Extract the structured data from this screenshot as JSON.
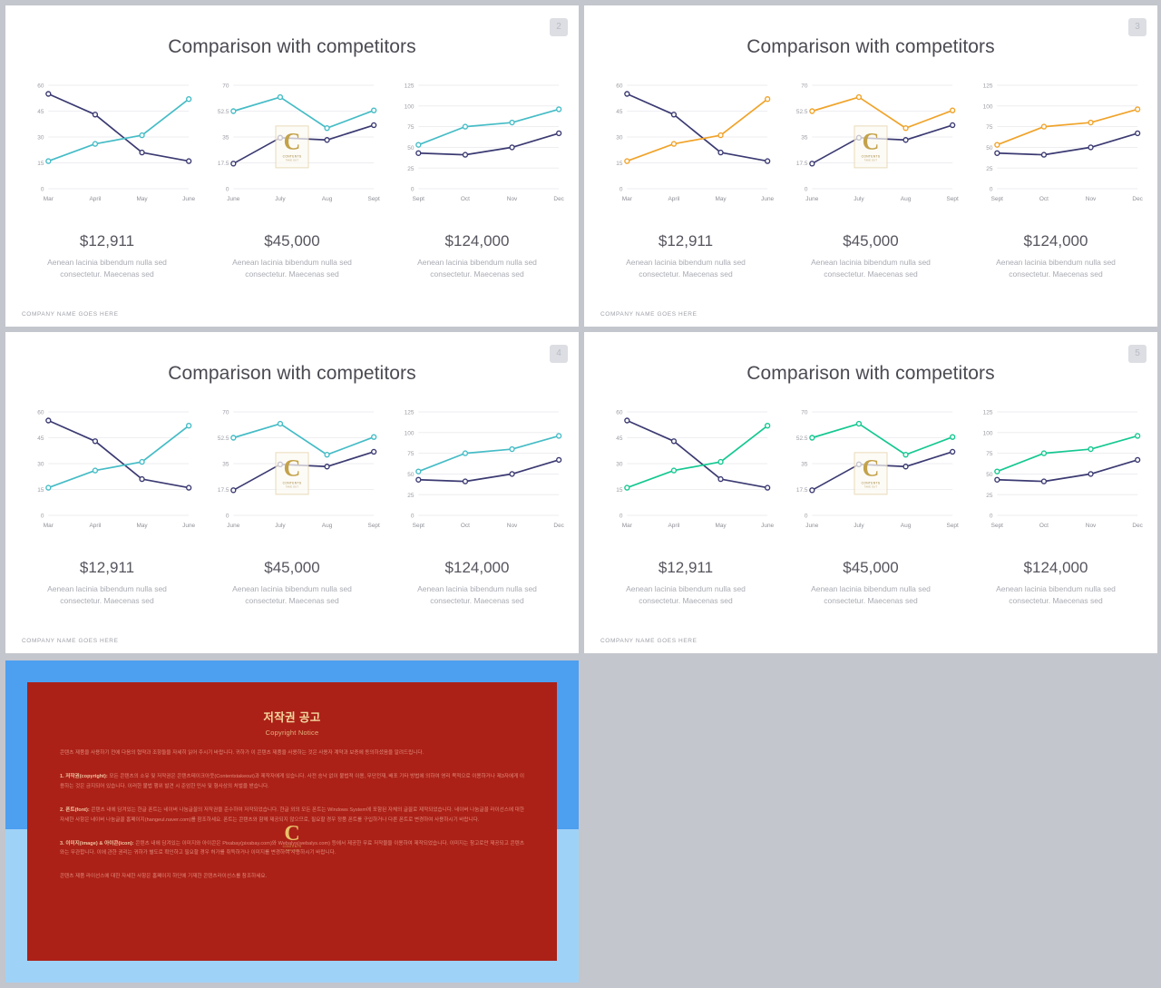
{
  "slides": [
    {
      "badge": "2",
      "title": "Comparison with competitors",
      "accent": "#45bcc6",
      "base": "#3b3a72",
      "footer": "COMPANY NAME GOES HERE",
      "watermark": {
        "letter": "C",
        "line1": "CONTENTS",
        "line2": "TAKE OUT"
      }
    },
    {
      "badge": "3",
      "title": "Comparison with competitors",
      "accent": "#f0a32a",
      "base": "#3b3a72",
      "footer": "COMPANY NAME GOES HERE",
      "watermark": {
        "letter": "C",
        "line1": "CONTENTS",
        "line2": "TAKE OUT"
      }
    },
    {
      "badge": "4",
      "title": "Comparison with competitors",
      "accent": "#45bcc6",
      "base": "#3b3a72",
      "footer": "COMPANY NAME GOES HERE",
      "watermark": {
        "letter": "C",
        "line1": "CONTENTS",
        "line2": "TAKE OUT"
      }
    },
    {
      "badge": "5",
      "title": "Comparison with competitors",
      "accent": "#15c891",
      "base": "#3b3a72",
      "footer": "COMPANY NAME GOES HERE",
      "watermark": {
        "letter": "C",
        "line1": "CONTENTS",
        "line2": "TAKE OUT"
      }
    }
  ],
  "chart_data": [
    {
      "type": "line",
      "title": "",
      "categories": [
        "Mar",
        "April",
        "May",
        "June"
      ],
      "yticks": [
        0,
        15,
        30,
        45,
        60
      ],
      "ylim": [
        0,
        60
      ],
      "grid": true,
      "legend": "none",
      "series": [
        {
          "name": "base",
          "values": [
            55,
            43,
            21,
            16
          ]
        },
        {
          "name": "accent",
          "values": [
            16,
            26,
            31,
            52
          ]
        }
      ],
      "value_label": "$12,911",
      "description": "Aenean lacinia bibendum nulla sed consectetur. Maecenas sed"
    },
    {
      "type": "line",
      "title": "",
      "categories": [
        "June",
        "July",
        "Aug",
        "Sept"
      ],
      "yticks": [
        0,
        17.5,
        35,
        52.5,
        70
      ],
      "ylim": [
        0,
        70
      ],
      "grid": true,
      "legend": "none",
      "series": [
        {
          "name": "accent",
          "values": [
            52.5,
            62,
            41,
            53
          ]
        },
        {
          "name": "base",
          "values": [
            17,
            34.5,
            33,
            43
          ]
        }
      ],
      "value_label": "$45,000",
      "description": "Aenean lacinia bibendum nulla sed consectetur. Maecenas sed"
    },
    {
      "type": "line",
      "title": "",
      "categories": [
        "Sept",
        "Oct",
        "Nov",
        "Dec"
      ],
      "yticks": [
        0,
        25,
        50,
        75,
        100,
        125
      ],
      "ylim": [
        0,
        125
      ],
      "grid": true,
      "legend": "none",
      "series": [
        {
          "name": "accent",
          "values": [
            53,
            75,
            80,
            96
          ]
        },
        {
          "name": "base",
          "values": [
            43,
            41,
            50,
            67
          ]
        }
      ],
      "value_label": "$124,000",
      "description": "Aenean lacinia bibendum nulla sed consectetur. Maecenas sed"
    }
  ],
  "notice": {
    "heading_ko": "저작권 공고",
    "heading_en": "Copyright Notice",
    "intro": "콘텐츠 제품을 사용하기 전에 다음의 협약과 조항들을 자세히 읽어 주시기 바랍니다. 귀하가 이 콘텐츠 제품을 사용하는 것은 사용자 계약과 보증에 동의하셨음을 알려드립니다.",
    "item1_label": "1. 저작권(copyright):",
    "item1_text": "모든 콘텐츠의 소유 및 저작권은 콘텐츠테이크아웃(Contentstakeout)과 제작자에게 있습니다. 사전 승낙 없이 불법적 이용, 무단전재, 배포 기타 방법에 의하여 영리 목적으로 이용하거나 제3자에게 이용하는 것은 금지되어 있습니다. 이러한 불법 행위 발견 시 준엄한 민사 및 형사상의 처벌을 받습니다.",
    "item2_label": "2. 폰트(font):",
    "item2_text": "콘텐츠 내에 담겨있는 한글 폰트는 네이버 나눔글꼴의 저작권을 준수하여 저작되었습니다. 한글 외의 모든 폰트는 Windows System에 포함된 자체의 글꼴로 제작되었습니다. 네이버 나눔글꼴 라이선스에 대한 자세한 사항은 네이버 나눔글꼴 홈페이지(hangeul.naver.com)를 참조하세요. 폰트는 콘텐츠와 함께 제공되지 않으므로, 필요할 경우 정품 폰트를 구입하거나 다른 폰트로 변경하여 사용하시기 바랍니다.",
    "item3_label": "3. 이미지(image) & 아이콘(icon):",
    "item3_text": "콘텐츠 내에 담겨있는 이미지와 아이콘은 Pixabay(pixabay.com)와 Webalys(webalys.com) 등에서 제공한 무료 저작물을 이용하여 제작되었습니다. 이미지는 참고로만 제공되고 콘텐츠와는 무관합니다. 이에 관한 권리는 귀하가 별도로 확인하고 필요할 경우 허가를 취득하거나 이미지를 변경하여 사용하시기 바랍니다.",
    "outro": "콘텐츠 제품 라이선스에 대한 자세한 사항은 홈페이지 하단에 기재한 콘텐츠라이선스를 참조하세요.",
    "watermark": {
      "letter": "C",
      "line1": "CONTENTS",
      "line2": "TAKE OUT"
    }
  }
}
